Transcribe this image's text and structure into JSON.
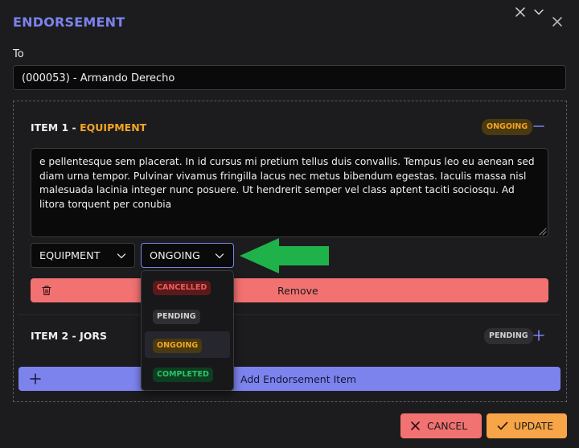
{
  "dialog": {
    "title": "ENDORSEMENT"
  },
  "to": {
    "label": "To",
    "value": "(000053) - Armando Derecho"
  },
  "items": [
    {
      "title_prefix": "ITEM 1 - ",
      "category_highlight": "EQUIPMENT",
      "status_badge": "ONGOING",
      "description": "e pellentesque sem placerat. In id cursus mi pretium tellus duis convallis. Tempus leo eu aenean sed diam urna tempor. Pulvinar vivamus fringilla lacus nec metus bibendum egestas. Iaculis massa nisl malesuada lacinia integer nunc posuere. Ut hendrerit semper vel class aptent taciti sociosqu. Ad litora torquent per conubia",
      "category_select": "EQUIPMENT",
      "status_select": "ONGOING",
      "remove_label": "Remove"
    },
    {
      "title": "ITEM 2 - JORS",
      "status_badge": "PENDING"
    }
  ],
  "status_options": [
    "CANCELLED",
    "PENDING",
    "ONGOING",
    "COMPLETED"
  ],
  "selected_status": "ONGOING",
  "add_label": "Add Endorsement Item",
  "footer": {
    "cancel_label": "CANCEL",
    "update_label": "UPDATE"
  },
  "colors": {
    "accent": "#7c83ec",
    "ongoing": "#f5a524",
    "danger": "#f27171",
    "success": "#29c566",
    "update": "#f7a547",
    "arrow": "#1fb24a"
  },
  "icons": [
    "close-icon",
    "clear-icon",
    "chevron-down-icon",
    "collapse-icon",
    "trash-icon",
    "expand-icon",
    "plus-icon",
    "x-icon",
    "check-icon",
    "green-arrow"
  ]
}
